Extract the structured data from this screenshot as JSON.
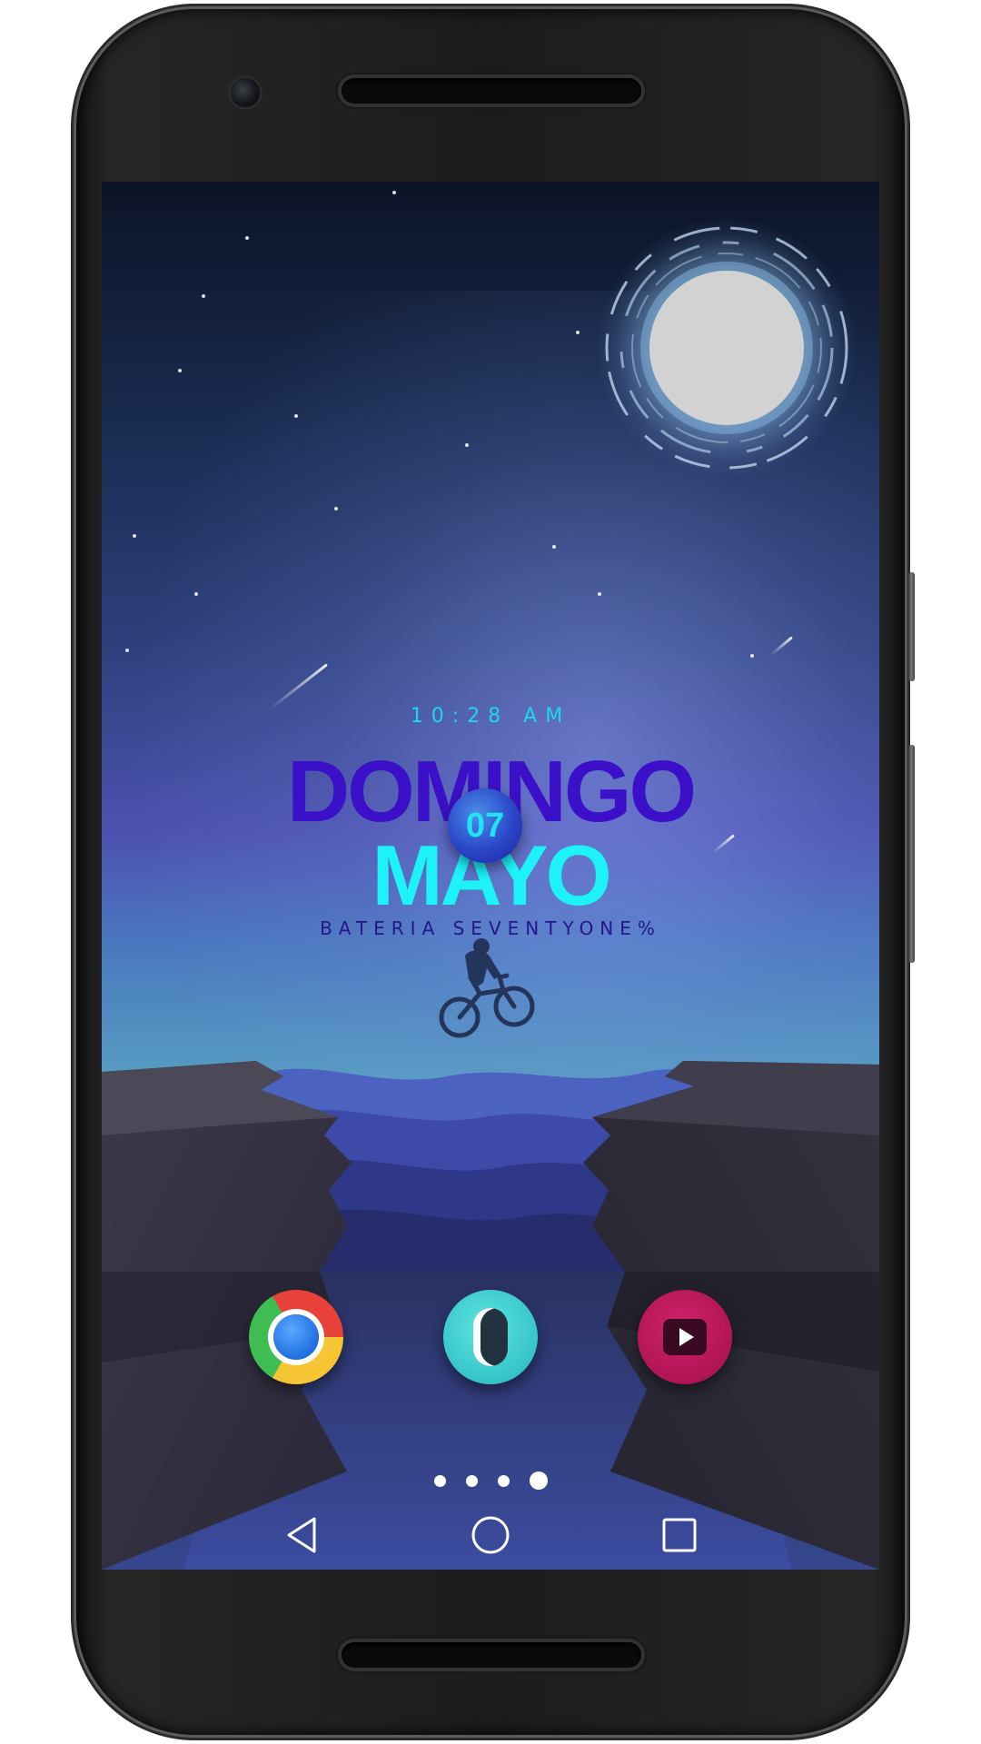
{
  "lockscreen": {
    "time": "10:28 AM",
    "day": "DOMINGO",
    "date": "07",
    "month": "MAYO",
    "battery": "BATERIA SEVENTYONE%"
  },
  "dock": {
    "apps": [
      {
        "icon": "chrome-icon"
      },
      {
        "icon": "launcher-app-icon"
      },
      {
        "icon": "video-player-icon"
      }
    ]
  },
  "pager": {
    "pages": 4,
    "current": 4
  },
  "navigation": {
    "buttons": [
      "back-icon",
      "home-icon",
      "recents-icon"
    ]
  },
  "colors": {
    "time": "#1ed6f0",
    "day": "#3c10c8",
    "month": "#1cf2f8",
    "battery": "#23178a",
    "date_badge": "#2a46c8"
  }
}
